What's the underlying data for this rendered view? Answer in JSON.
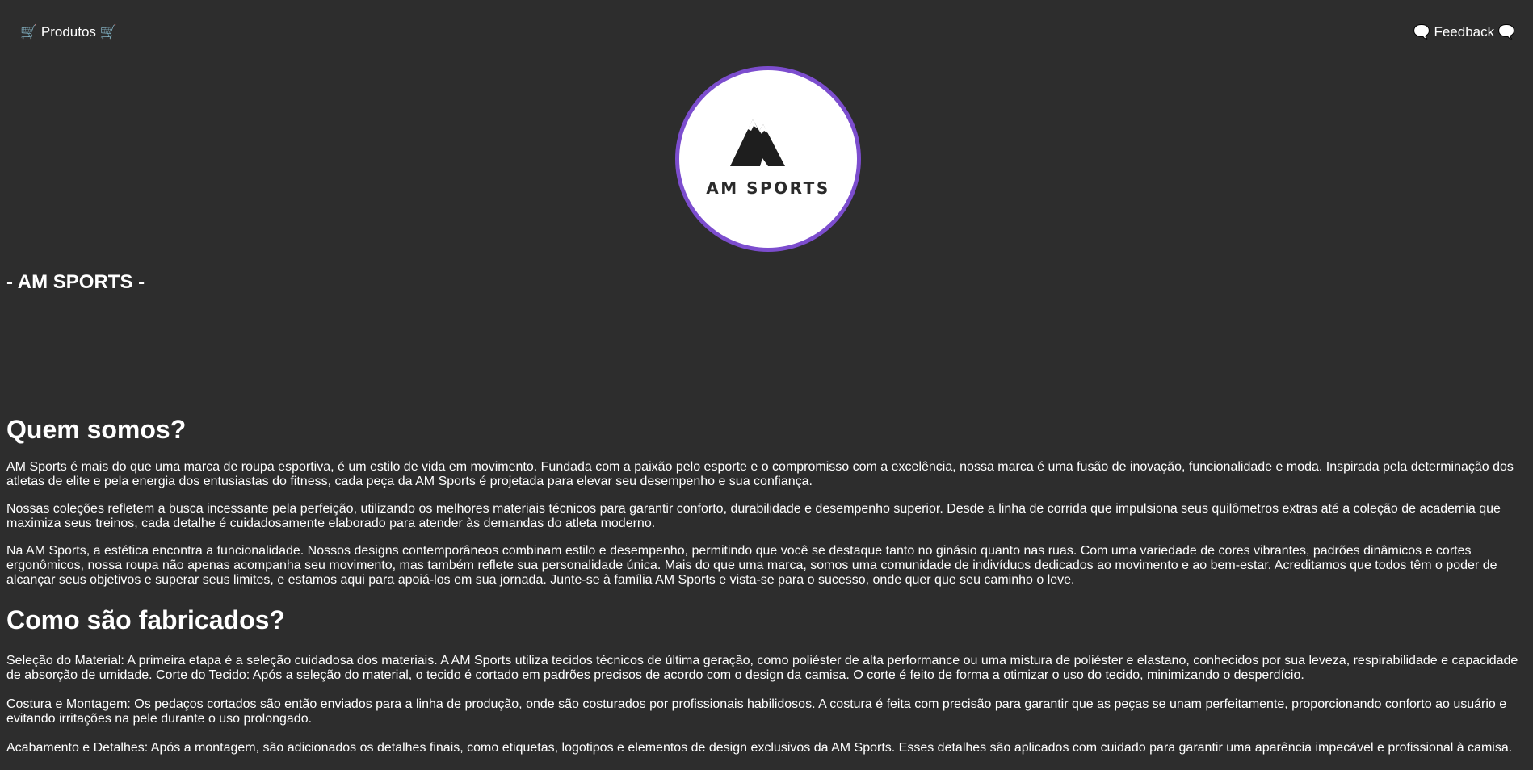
{
  "nav": {
    "products_label": "🛒 Produtos 🛒",
    "feedback_label": "🗨️ Feedback 🗨️"
  },
  "logo": {
    "text": "AM SPORTS",
    "ring_color": "#7c4dce"
  },
  "brand_line": "- AM SPORTS -",
  "about": {
    "heading": "Quem somos?",
    "paragraphs": [
      "AM Sports é mais do que uma marca de roupa esportiva, é um estilo de vida em movimento. Fundada com a paixão pelo esporte e o compromisso com a excelência, nossa marca é uma fusão de inovação, funcionalidade e moda. Inspirada pela determinação dos atletas de elite e pela energia dos entusiastas do fitness, cada peça da AM Sports é projetada para elevar seu desempenho e sua confiança.",
      "Nossas coleções refletem a busca incessante pela perfeição, utilizando os melhores materiais técnicos para garantir conforto, durabilidade e desempenho superior. Desde a linha de corrida que impulsiona seus quilômetros extras até a coleção de academia que maximiza seus treinos, cada detalhe é cuidadosamente elaborado para atender às demandas do atleta moderno.",
      "Na AM Sports, a estética encontra a funcionalidade. Nossos designs contemporâneos combinam estilo e desempenho, permitindo que você se destaque tanto no ginásio quanto nas ruas. Com uma variedade de cores vibrantes, padrões dinâmicos e cortes ergonômicos, nossa roupa não apenas acompanha seu movimento, mas também reflete sua personalidade única. Mais do que uma marca, somos uma comunidade de indivíduos dedicados ao movimento e ao bem-estar. Acreditamos que todos têm o poder de alcançar seus objetivos e superar seus limites, e estamos aqui para apoiá-los em sua jornada. Junte-se à família AM Sports e vista-se para o sucesso, onde quer que seu caminho o leve."
    ]
  },
  "manufacturing": {
    "heading": "Como são fabricados?",
    "paragraphs": [
      "Seleção do Material: A primeira etapa é a seleção cuidadosa dos materiais. A AM Sports utiliza tecidos técnicos de última geração, como poliéster de alta performance ou uma mistura de poliéster e elastano, conhecidos por sua leveza, respirabilidade e capacidade de absorção de umidade. Corte do Tecido: Após a seleção do material, o tecido é cortado em padrões precisos de acordo com o design da camisa. O corte é feito de forma a otimizar o uso do tecido, minimizando o desperdício.",
      "Costura e Montagem: Os pedaços cortados são então enviados para a linha de produção, onde são costurados por profissionais habilidosos. A costura é feita com precisão para garantir que as peças se unam perfeitamente, proporcionando conforto ao usuário e evitando irritações na pele durante o uso prolongado.",
      "Acabamento e Detalhes: Após a montagem, são adicionados os detalhes finais, como etiquetas, logotipos e elementos de design exclusivos da AM Sports. Esses detalhes são aplicados com cuidado para garantir uma aparência impecável e profissional à camisa."
    ]
  }
}
